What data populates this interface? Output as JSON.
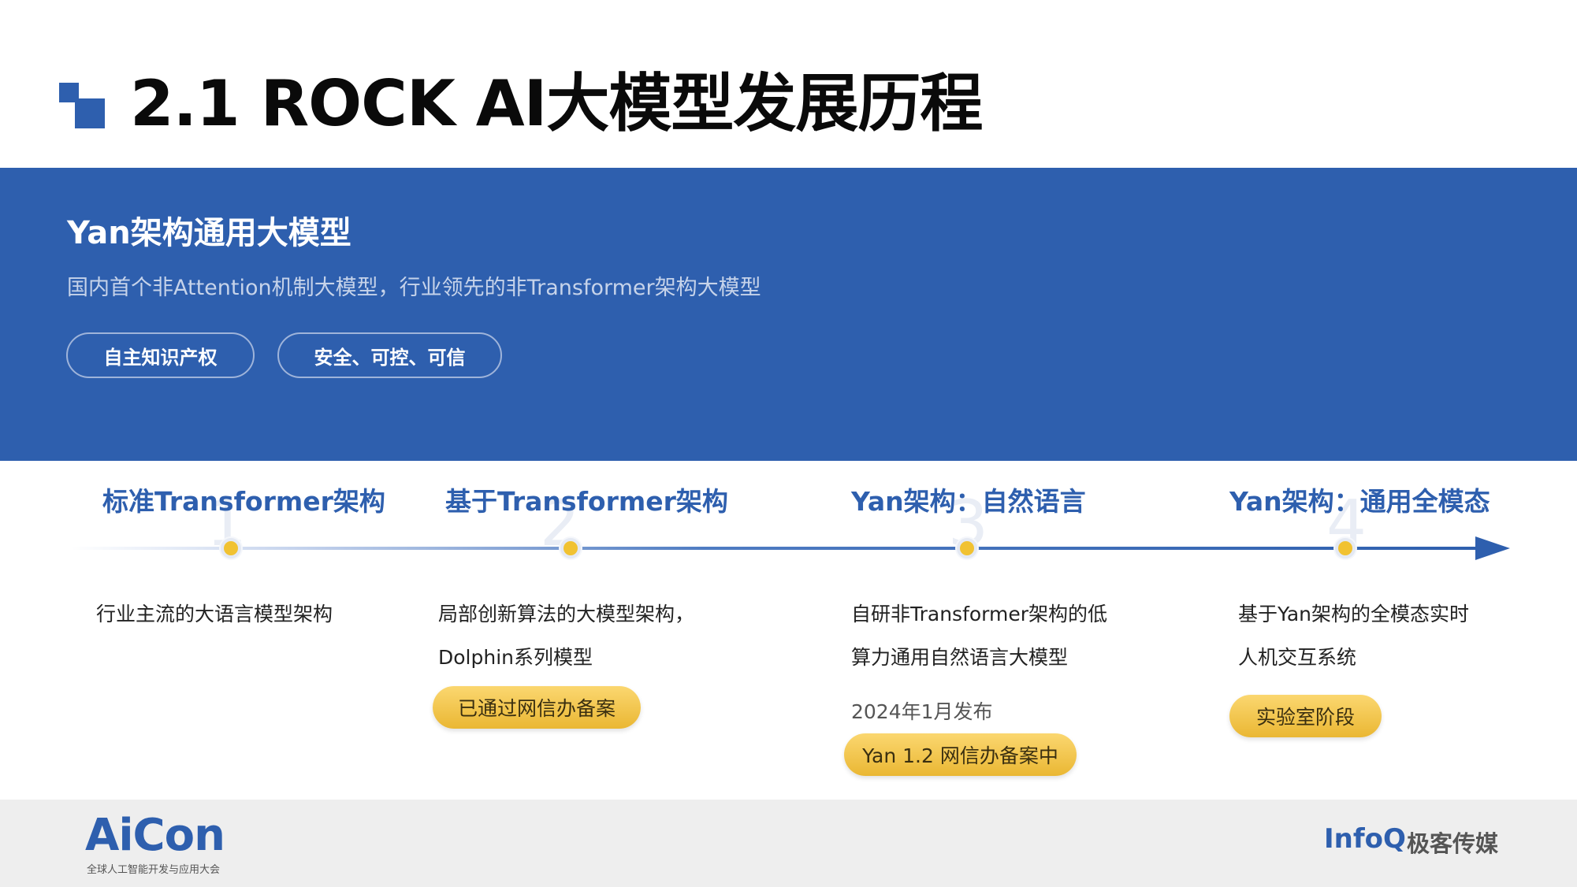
{
  "header": {
    "title": "2.1 ROCK AI大模型发展历程"
  },
  "banner": {
    "title": "Yan架构通用大模型",
    "description": "国内首个非Attention机制大模型，行业领先的非Transformer架构大模型",
    "tags": [
      "自主知识产权",
      "安全、可控、可信"
    ]
  },
  "timeline": {
    "stages": [
      {
        "number": "1",
        "title": "标准Transformer架构",
        "desc_lines": [
          "行业主流的大语言模型架构"
        ]
      },
      {
        "number": "2",
        "title": "基于Transformer架构",
        "desc_lines": [
          "局部创新算法的大模型架构，",
          "Dolphin系列模型"
        ],
        "badge": "已通过网信办备案"
      },
      {
        "number": "3",
        "title": "Yan架构：自然语言",
        "desc_lines": [
          "自研非Transformer架构的低",
          "算力通用自然语言大模型"
        ],
        "date": "2024年1月发布",
        "badge": "Yan 1.2  网信办备案中"
      },
      {
        "number": "4",
        "title": "Yan架构：通用全模态",
        "desc_lines": [
          "基于Yan架构的全模态实时",
          "人机交互系统"
        ],
        "badge": "实验室阶段"
      }
    ]
  },
  "footer": {
    "logo": "AiCon",
    "logo_subtitle": "全球人工智能开发与应用大会",
    "brand_en": "InfoQ",
    "brand_cn": "极客传媒"
  },
  "colors": {
    "primary_blue": "#2e5fae",
    "badge_gold": "#f1c232",
    "footer_gray": "#eeeeee"
  }
}
